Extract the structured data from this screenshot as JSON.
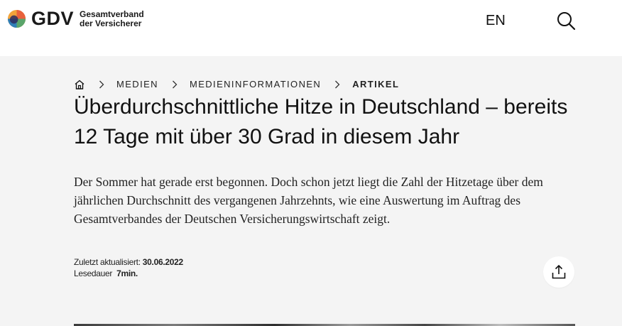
{
  "header": {
    "logo": {
      "brand": "GDV",
      "subtitle_line1": "Gesamtverband",
      "subtitle_line2": "der Versicherer"
    },
    "language_label": "EN",
    "icons": {
      "search": "search-icon"
    }
  },
  "breadcrumb": {
    "home_icon": "home-icon",
    "items": [
      "MEDIEN",
      "MEDIENINFORMATIONEN",
      "ARTIKEL"
    ]
  },
  "article": {
    "title": "Überdurchschnittliche Hitze in Deutschland – be­reits 12 Tage mit über 30 Grad in diesem Jahr",
    "lead": "Der Sommer hat gerade erst begonnen. Doch schon jetzt liegt die Zahl der Hitzetage über dem jährlichen Durchschnitt des vergangenen Jahrzehnts, wie eine Auswertung im Auftrag des Gesamtverbandes der Deutschen Versicherungswirtschaft zeigt.",
    "updated_label": "Zuletzt aktualisiert:",
    "updated_value": "30.06.2022",
    "reading_label": "Lesedauer",
    "reading_value": "7min."
  },
  "share": {
    "icon": "share-icon"
  },
  "colors": {
    "header_bg": "#ffffff",
    "page_bg": "#f4f4f4",
    "text": "#111111"
  }
}
